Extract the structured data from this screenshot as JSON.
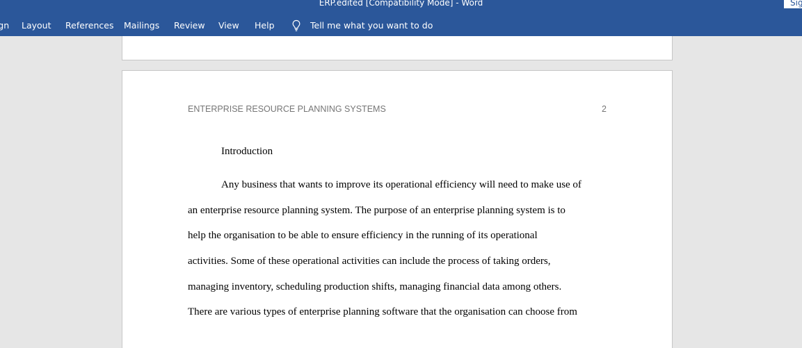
{
  "window": {
    "title": "ERP.edited [Compatibility Mode]  -  Word",
    "signin_label": "Sign in"
  },
  "ribbon": {
    "tabs": [
      {
        "label": "Design"
      },
      {
        "label": "Layout"
      },
      {
        "label": "References"
      },
      {
        "label": "Mailings"
      },
      {
        "label": "Review"
      },
      {
        "label": "View"
      },
      {
        "label": "Help"
      }
    ],
    "tell_me": {
      "icon": "lightbulb-icon",
      "label": "Tell me what you want to do"
    }
  },
  "document": {
    "header": {
      "running_head": "ENTERPRISE RESOURCE PLANNING SYSTEMS",
      "page_number": "2"
    },
    "heading": "Introduction",
    "paragraph_lines": [
      "Any business that wants to improve its operational efficiency will need to make use of",
      "an enterprise resource planning system. The purpose of an enterprise planning system is to",
      "help the organisation to be able to ensure efficiency in the running of its operational",
      "activities.  Some of these operational activities can include the process of taking orders,",
      "managing inventory, scheduling production shifts, managing financial data among others.",
      "There are various types of enterprise planning software that the organisation can choose from"
    ]
  },
  "colors": {
    "ribbon_blue": "#2b579a",
    "workspace_gray": "#e6e6e6",
    "header_text_gray": "#767676"
  }
}
